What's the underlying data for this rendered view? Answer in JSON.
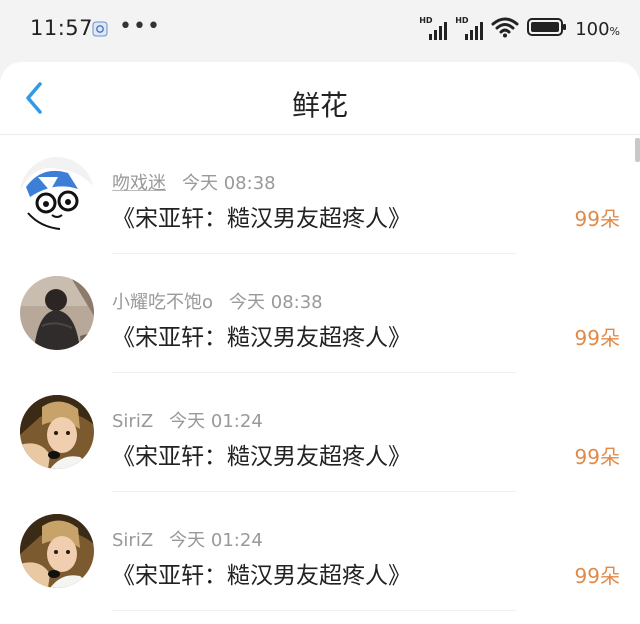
{
  "status_bar": {
    "time": "11:57",
    "more": "•••",
    "hd1": "HD",
    "hd2": "HD",
    "battery_value": "100",
    "battery_unit": "%"
  },
  "header": {
    "title": "鲜花",
    "back_icon": "chevron-left-icon",
    "accent_color": "#2f9be8"
  },
  "gift_records": [
    {
      "user": "吻戏迷",
      "time": "今天 08:38",
      "gift": "《宋亚轩：糙汉男友超疼人》",
      "amount": "99朵"
    },
    {
      "user": "小耀吃不饱o",
      "time": "今天 08:38",
      "gift": "《宋亚轩：糙汉男友超疼人》",
      "amount": "99朵"
    },
    {
      "user": "SiriZ",
      "time": "今天 01:24",
      "gift": "《宋亚轩：糙汉男友超疼人》",
      "amount": "99朵"
    },
    {
      "user": "SiriZ",
      "time": "今天 01:24",
      "gift": "《宋亚轩：糙汉男友超疼人》",
      "amount": "99朵"
    }
  ],
  "colors": {
    "amount": "#e08a4a",
    "meta": "#999999",
    "text": "#222222"
  }
}
